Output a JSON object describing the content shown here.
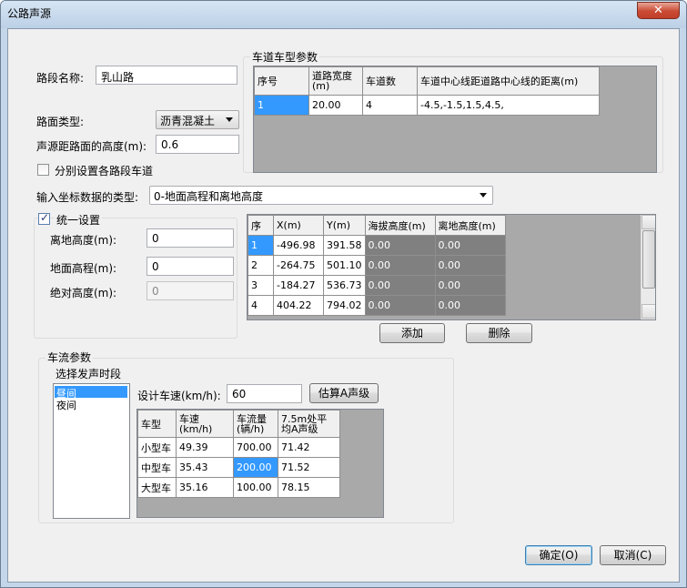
{
  "window": {
    "title": "公路声源",
    "close_label": "✕"
  },
  "basic": {
    "road_name_label": "路段名称:",
    "road_name_value": "乳山路",
    "surface_label": "路面类型:",
    "surface_value": "沥青混凝土",
    "source_height_label": "声源距路面的高度(m):",
    "source_height_value": "0.6",
    "separate_lanes_label": "分别设置各路段车道",
    "coord_type_label": "输入坐标数据的类型:",
    "coord_type_value": "0-地面高程和离地高度"
  },
  "lane_group": {
    "title": "车道车型参数",
    "headers": [
      "序号",
      "道路宽度(m)",
      "车道数",
      "车道中心线距道路中心线的距离(m)"
    ],
    "rows": [
      [
        "1",
        "20.00",
        "4",
        "-4.5,-1.5,1.5,4.5,"
      ]
    ]
  },
  "unify": {
    "checkbox_label": "统一设置",
    "checked": true,
    "ground_height_label": "离地高度(m):",
    "ground_height_value": "0",
    "ground_elev_label": "地面高程(m):",
    "ground_elev_value": "0",
    "abs_height_label": "绝对高度(m):",
    "abs_height_value": "0"
  },
  "coords": {
    "headers": [
      "序",
      "X(m)",
      "Y(m)",
      "海拔高度(m)",
      "离地高度(m)"
    ],
    "rows": [
      [
        "1",
        "-496.98",
        "391.58",
        "0.00",
        "0.00"
      ],
      [
        "2",
        "-264.75",
        "501.10",
        "0.00",
        "0.00"
      ],
      [
        "3",
        "-184.27",
        "536.73",
        "0.00",
        "0.00"
      ],
      [
        "4",
        "404.22",
        "794.02",
        "0.00",
        "0.00"
      ]
    ],
    "add_label": "添加",
    "delete_label": "删除"
  },
  "traffic": {
    "group_title": "车流参数",
    "period_label": "选择发声时段",
    "periods": [
      "昼间",
      "夜间"
    ],
    "selected_period": "昼间",
    "speed_label": "设计车速(km/h):",
    "speed_value": "60",
    "estimate_label": "估算A声级",
    "headers": [
      "车型",
      "车速\n(km/h)",
      "车流量\n(辆/h)",
      "7.5m处平\n均A声级"
    ],
    "rows": [
      [
        "小型车",
        "49.39",
        "700.00",
        "71.42"
      ],
      [
        "中型车",
        "35.43",
        "200.00",
        "71.52"
      ],
      [
        "大型车",
        "35.16",
        "100.00",
        "78.15"
      ]
    ]
  },
  "footer": {
    "ok_label": "确定(O)",
    "cancel_label": "取消(C)"
  }
}
